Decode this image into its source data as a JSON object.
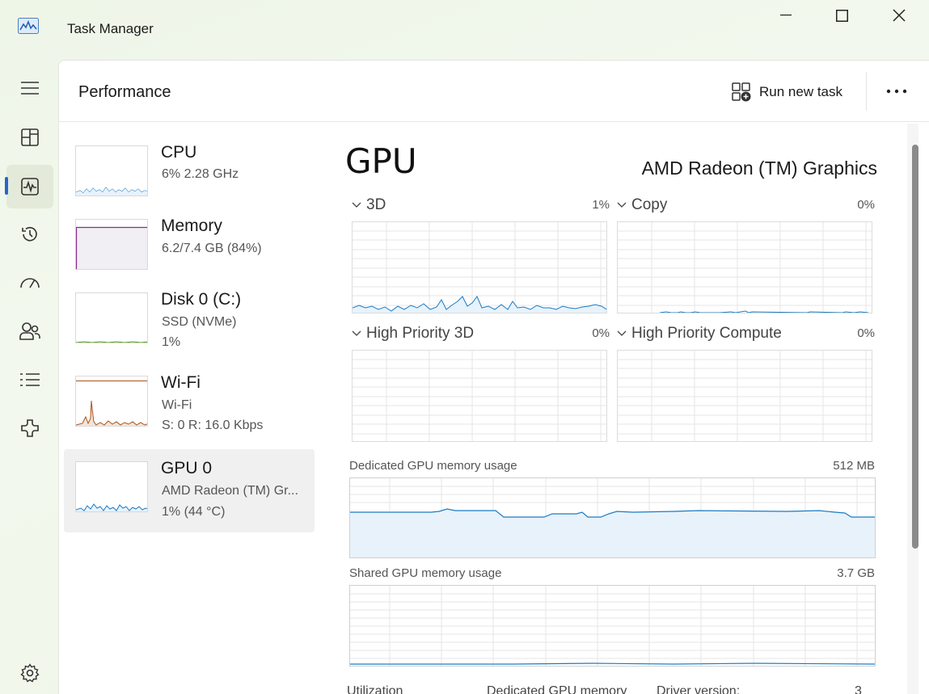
{
  "window": {
    "title": "Task Manager"
  },
  "header": {
    "page_title": "Performance",
    "run_new_task_label": "Run new task"
  },
  "nav": {
    "items": [
      {
        "name": "hamburger-menu-icon"
      },
      {
        "name": "processes-icon"
      },
      {
        "name": "performance-icon",
        "active": true
      },
      {
        "name": "app-history-icon"
      },
      {
        "name": "startup-apps-icon"
      },
      {
        "name": "users-icon"
      },
      {
        "name": "details-icon"
      },
      {
        "name": "services-icon"
      },
      {
        "name": "settings-icon"
      }
    ]
  },
  "devices": [
    {
      "name": "CPU",
      "line1": "6%  2.28 GHz",
      "line2": "",
      "color": "#1a7bc4"
    },
    {
      "name": "Memory",
      "line1": "6.2/7.4 GB (84%)",
      "line2": "",
      "color": "#8b2a8b"
    },
    {
      "name": "Disk 0 (C:)",
      "line1": "SSD (NVMe)",
      "line2": "1%",
      "color": "#4d9a06"
    },
    {
      "name": "Wi-Fi",
      "line1": "Wi-Fi",
      "line2": "S: 0  R: 16.0 Kbps",
      "color": "#a7541b"
    },
    {
      "name": "GPU 0",
      "line1": "AMD Radeon (TM) Gr...",
      "line2": "1%  (44 °C)",
      "color": "#1a7bc4",
      "selected": true
    }
  ],
  "gpu": {
    "title": "GPU",
    "model": "AMD Radeon (TM) Graphics",
    "engines": [
      {
        "label": "3D",
        "value": "1%"
      },
      {
        "label": "Copy",
        "value": "0%"
      },
      {
        "label": "High Priority 3D",
        "value": "0%"
      },
      {
        "label": "High Priority Compute",
        "value": "0%"
      }
    ],
    "dedicated_memory": {
      "label": "Dedicated GPU memory usage",
      "value": "512 MB"
    },
    "shared_memory": {
      "label": "Shared GPU memory usage",
      "value": "3.7 GB"
    },
    "bottom_labels": {
      "utilization": "Utilization",
      "dedicated": "Dedicated GPU memory",
      "driver": "Driver version:",
      "driver_value": "3"
    }
  },
  "colors": {
    "accent": "#2766c9",
    "gpu_line": "#1a7bc4",
    "graph_grid": "#e6e6e6"
  }
}
